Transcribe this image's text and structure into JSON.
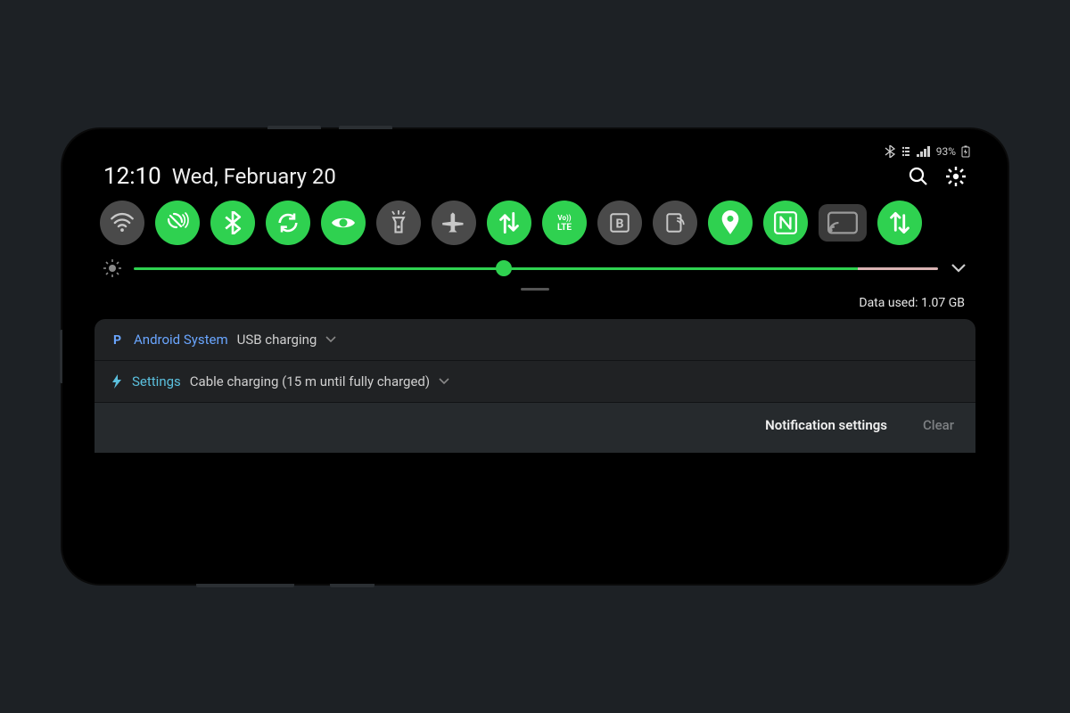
{
  "statusbar": {
    "battery_text": "93%"
  },
  "header": {
    "time": "12:10",
    "date": "Wed, February 20"
  },
  "tiles": [
    {
      "name": "wifi",
      "state": "off"
    },
    {
      "name": "vibrate",
      "state": "on"
    },
    {
      "name": "bluetooth",
      "state": "on"
    },
    {
      "name": "auto-rotate",
      "state": "on"
    },
    {
      "name": "eye-comfort",
      "state": "on"
    },
    {
      "name": "flashlight",
      "state": "off"
    },
    {
      "name": "airplane",
      "state": "off"
    },
    {
      "name": "mobile-data",
      "state": "on"
    },
    {
      "name": "volte",
      "state": "on"
    },
    {
      "name": "bold-text",
      "state": "off"
    },
    {
      "name": "mobile-hotspot",
      "state": "off"
    },
    {
      "name": "location",
      "state": "on"
    },
    {
      "name": "nfc",
      "state": "on"
    },
    {
      "name": "cast",
      "state": "special"
    },
    {
      "name": "sync",
      "state": "on"
    }
  ],
  "brightness": {
    "percent": 46,
    "auto_limit": 90
  },
  "data_used": "Data used: 1.07 GB",
  "notifications": [
    {
      "icon": "p",
      "app": "Android System",
      "msg": "USB charging"
    },
    {
      "icon": "bolt",
      "app": "Settings",
      "msg": "Cable charging (15 m until fully charged)"
    }
  ],
  "actions": {
    "settings": "Notification settings",
    "clear": "Clear"
  },
  "colors": {
    "accent": "#2fd150",
    "tile_off": "#4a4a4a",
    "link": "#6aa6ff"
  }
}
